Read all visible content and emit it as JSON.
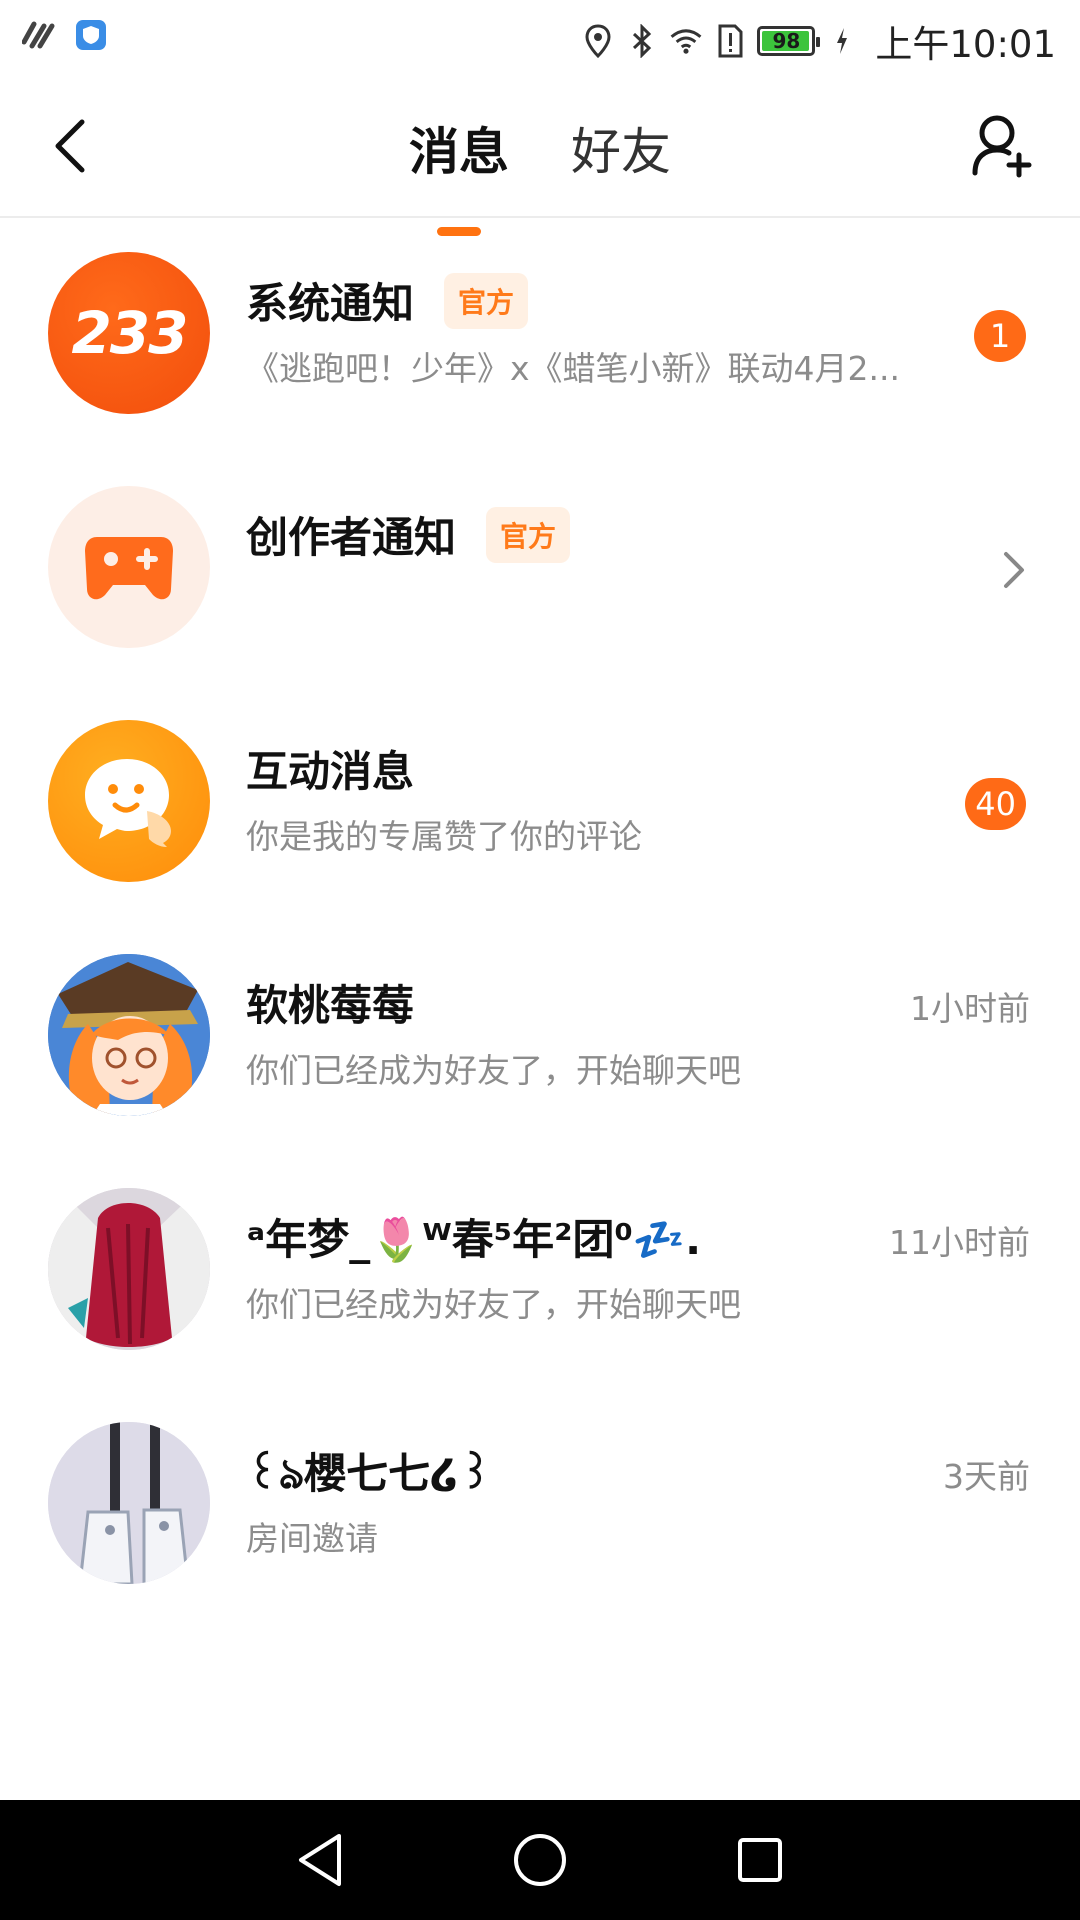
{
  "status_bar": {
    "battery": "98",
    "battery_level": 0.98,
    "time": "上午10:01"
  },
  "header": {
    "tabs": [
      {
        "label": "消息",
        "active": true
      },
      {
        "label": "好友",
        "active": false
      }
    ]
  },
  "colors": {
    "accent": "#ff7210",
    "badge": "#ff6a16",
    "tag_text": "#ff7a1a",
    "tag_bg": "#fff0e3"
  },
  "messages": [
    {
      "title": "系统通知",
      "tag": "官方",
      "subtitle": "《逃跑吧！少年》x《蜡笔小新》联动4月2...",
      "badge": "1",
      "avatar_text": "233"
    },
    {
      "title": "创作者通知",
      "tag": "官方",
      "subtitle": "",
      "icon": "gamepad-icon"
    },
    {
      "title": "互动消息",
      "subtitle": "你是我的专属赞了你的评论",
      "badge": "40",
      "icon": "chat-smile-icon"
    },
    {
      "title": "软桃莓莓",
      "subtitle": "你们已经成为好友了，开始聊天吧",
      "time": "1小时前"
    },
    {
      "title": "ᵃ年梦_🌷ᵂ春⁵年²团⁰💤.",
      "subtitle": "你们已经成为好友了，开始聊天吧",
      "time": "11小时前"
    },
    {
      "title": "꒰ঌ櫻七七໒꒱",
      "subtitle": "房间邀请",
      "time": "3天前"
    }
  ]
}
